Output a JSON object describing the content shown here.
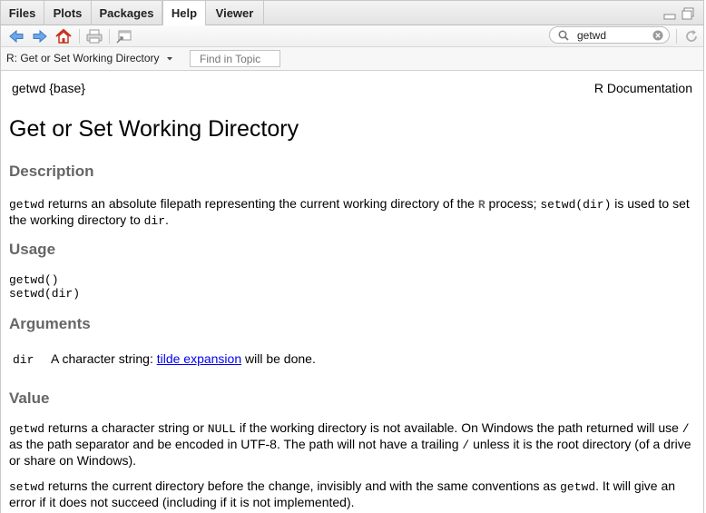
{
  "tabs": [
    {
      "label": "Files"
    },
    {
      "label": "Plots"
    },
    {
      "label": "Packages"
    },
    {
      "label": "Help"
    },
    {
      "label": "Viewer"
    }
  ],
  "search": {
    "value": "getwd"
  },
  "topic_selector": {
    "label": "R: Get or Set Working Directory"
  },
  "find": {
    "placeholder": "Find in Topic"
  },
  "doc": {
    "name_pkg": "getwd {base}",
    "r_documentation": "R Documentation",
    "title": "Get or Set Working Directory",
    "description": {
      "heading": "Description",
      "t1": "getwd",
      "t2": " returns an absolute filepath representing the current working directory of the ",
      "t3": "R",
      "t4": " process; ",
      "t5": "setwd(dir)",
      "t6": " is used to set the working directory to ",
      "t7": "dir",
      "t8": "."
    },
    "usage": {
      "heading": "Usage",
      "line1": "getwd()",
      "line2": "setwd(dir)"
    },
    "arguments": {
      "heading": "Arguments",
      "arg_name": "dir",
      "text_before": "A character string: ",
      "link": "tilde expansion",
      "text_after": " will be done."
    },
    "value": {
      "heading": "Value",
      "p1_code1": "getwd",
      "p1_t1": " returns a character string or ",
      "p1_code2": "NULL",
      "p1_t2": " if the working directory is not available. On Windows the path returned will use ",
      "p1_code3": "/",
      "p1_t3": " as the path separator and be encoded in UTF-8. The path will not have a trailing ",
      "p1_code4": "/",
      "p1_t4": " unless it is the root directory (of a drive or share on Windows).",
      "p2_code1": "setwd",
      "p2_t1": " returns the current directory before the change, invisibly and with the same conventions as ",
      "p2_code2": "getwd",
      "p2_t2": ". It will give an error if it does not succeed (including if it is not implemented)."
    }
  },
  "colors": {
    "heading_gray": "#666666",
    "link_blue": "#0000ee",
    "nav_arrow_blue": "#4d8fd9",
    "home_red": "#d9462b"
  }
}
